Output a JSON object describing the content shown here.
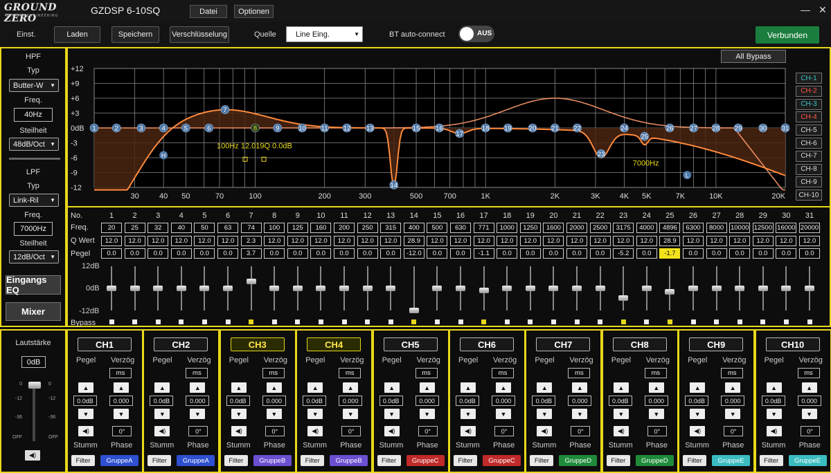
{
  "app": {
    "logo": "GROUND ZERO",
    "logo_sub": "GERMAN ENGINEERING",
    "title": "GZDSP 6-10SQ"
  },
  "menu": {
    "file": "Datei",
    "options": "Optionen"
  },
  "window": {
    "minimize": "—",
    "close": "✕"
  },
  "toolbar": {
    "settings": "Einst.",
    "load": "Laden",
    "save": "Speichern",
    "encryption": "Verschlüsselung",
    "source_label": "Quelle",
    "source_value": "Line Eing.",
    "bt_label": "BT auto-connect",
    "bt_state": "AUS",
    "status": "Verbunden"
  },
  "hpf": {
    "title": "HPF",
    "type_label": "Typ",
    "type_value": "Butter-W",
    "freq_label": "Freq.",
    "freq_value": "40Hz",
    "slope_label": "Steilheit",
    "slope_value": "48dB/Oct"
  },
  "lpf": {
    "title": "LPF",
    "type_label": "Typ",
    "type_value": "Link-Ril",
    "freq_label": "Freq.",
    "freq_value": "7000Hz",
    "slope_label": "Steilheit",
    "slope_value": "12dB/Oct"
  },
  "side_buttons": {
    "input_eq": "Eingangs EQ",
    "mixer": "Mixer"
  },
  "graph": {
    "all_bypass": "All Bypass",
    "y_ticks": [
      "+12",
      "+9",
      "+6",
      "+3",
      "0dB",
      "-3",
      "-6",
      "-9",
      "-12"
    ],
    "x_ticks": [
      "30",
      "40",
      "50",
      "70",
      "100",
      "200",
      "300",
      "500",
      "700",
      "1K",
      "2K",
      "3K",
      "4K",
      "5K",
      "7K",
      "10K",
      "20K"
    ],
    "annotation_bell": "100Hz 12.019Q 0.0dB",
    "annotation_lpf": "7000Hz",
    "marker_h": "H",
    "marker_l": "L",
    "colors": {
      "curve": "#ff8a3c",
      "fill": "#4a2410",
      "grid": "#8a8a8a",
      "points": "#4e78a8",
      "active_point": "#c8e34a"
    }
  },
  "channels_side": [
    {
      "label": "CH-1",
      "color": "#3ec6c6"
    },
    {
      "label": "CH-2",
      "color": "#ff5a4a"
    },
    {
      "label": "CH-3",
      "color": "#3ec6c6"
    },
    {
      "label": "CH-4",
      "color": "#ff5a4a"
    },
    {
      "label": "CH-5",
      "color": "#dddddd"
    },
    {
      "label": "CH-6",
      "color": "#dddddd"
    },
    {
      "label": "CH-7",
      "color": "#dddddd"
    },
    {
      "label": "CH-8",
      "color": "#dddddd"
    },
    {
      "label": "CH-9",
      "color": "#dddddd"
    },
    {
      "label": "CH-10",
      "color": "#dddddd"
    }
  ],
  "eq_table": {
    "row_labels": {
      "no": "No.",
      "freq": "Freq.",
      "q": "Q Wert",
      "gain": "Pegel",
      "bypass": "Bypass"
    },
    "scale": {
      "top": "12dB",
      "mid": "0dB",
      "bottom": "-12dB"
    },
    "numbers": [
      "1",
      "2",
      "3",
      "4",
      "5",
      "6",
      "7",
      "8",
      "9",
      "10",
      "11",
      "12",
      "13",
      "14",
      "15",
      "16",
      "17",
      "18",
      "19",
      "20",
      "21",
      "22",
      "23",
      "24",
      "25",
      "26",
      "27",
      "28",
      "29",
      "30",
      "31"
    ],
    "freq": [
      "20",
      "25",
      "32",
      "40",
      "50",
      "63",
      "74",
      "100",
      "125",
      "160",
      "200",
      "250",
      "315",
      "400",
      "500",
      "630",
      "771",
      "1000",
      "1250",
      "1600",
      "2000",
      "2500",
      "3175",
      "4000",
      "4896",
      "6300",
      "8000",
      "10000",
      "12500",
      "16000",
      "20000"
    ],
    "q": [
      "12.0",
      "12.0",
      "12.0",
      "12.0",
      "12.0",
      "12.0",
      "2.3",
      "12.0",
      "12.0",
      "12.0",
      "12.0",
      "12.0",
      "12.0",
      "28.9",
      "12.0",
      "12.0",
      "12.0",
      "12.0",
      "12.0",
      "12.0",
      "12.0",
      "12.0",
      "12.0",
      "12.0",
      "28.9",
      "12.0",
      "12.0",
      "12.0",
      "12.0",
      "12.0",
      "12.0"
    ],
    "gain": [
      "0.0",
      "0.0",
      "0.0",
      "0.0",
      "0.0",
      "0.0",
      "3.7",
      "0.0",
      "0.0",
      "0.0",
      "0.0",
      "0.0",
      "0.0",
      "-12.0",
      "0.0",
      "0.0",
      "-1.1",
      "0.0",
      "0.0",
      "0.0",
      "0.0",
      "0.0",
      "-5.2",
      "0.0",
      "-1.7",
      "0.0",
      "0.0",
      "0.0",
      "0.0",
      "0.0",
      "0.0"
    ],
    "gain_db": [
      0,
      0,
      0,
      0,
      0,
      0,
      3.7,
      0,
      0,
      0,
      0,
      0,
      0,
      -12,
      0,
      0,
      -1.1,
      0,
      0,
      0,
      0,
      0,
      -5.2,
      0,
      -1.7,
      0,
      0,
      0,
      0,
      0,
      0
    ],
    "selected_band": 25,
    "bypass_active": [
      7,
      14,
      17,
      23,
      25
    ]
  },
  "master": {
    "title": "Lautstärke",
    "value": "0dB",
    "level": 1.0,
    "scale_left": [
      "0",
      "-12",
      "-36",
      "OFF"
    ],
    "scale_right": [
      "0",
      "-12",
      "-36",
      "OFF"
    ]
  },
  "strip_labels": {
    "level": "Pegel",
    "delay": "Verzög",
    "ms": "ms",
    "mute": "Stumm",
    "phase": "Phase",
    "filter": "Filter"
  },
  "strips": [
    {
      "name": "CH1",
      "level": "0.0dB",
      "delay": "0.000",
      "phase": "0°",
      "group": "GruppeA",
      "group_color": "#2d4fd0",
      "highlight": false
    },
    {
      "name": "CH2",
      "level": "0.0dB",
      "delay": "0.000",
      "phase": "0°",
      "group": "GruppeA",
      "group_color": "#2d4fd0",
      "highlight": false
    },
    {
      "name": "CH3",
      "level": "0.0dB",
      "delay": "0.000",
      "phase": "0°",
      "group": "GruppeB",
      "group_color": "#6b4fd0",
      "highlight": true
    },
    {
      "name": "CH4",
      "level": "0.0dB",
      "delay": "0.000",
      "phase": "0°",
      "group": "GruppeB",
      "group_color": "#6b4fd0",
      "highlight": true
    },
    {
      "name": "CH5",
      "level": "0.0dB",
      "delay": "0.000",
      "phase": "0°",
      "group": "GruppeC",
      "group_color": "#c02a2a",
      "highlight": false
    },
    {
      "name": "CH6",
      "level": "0.0dB",
      "delay": "0.000",
      "phase": "0°",
      "group": "GruppeC",
      "group_color": "#c02a2a",
      "highlight": false
    },
    {
      "name": "CH7",
      "level": "0.0dB",
      "delay": "0.000",
      "phase": "0°",
      "group": "GruppeD",
      "group_color": "#1f8a3a",
      "highlight": false
    },
    {
      "name": "CH8",
      "level": "0.0dB",
      "delay": "0.000",
      "phase": "0°",
      "group": "GruppeD",
      "group_color": "#1f8a3a",
      "highlight": false
    },
    {
      "name": "CH9",
      "level": "0.0dB",
      "delay": "0.000",
      "phase": "0°",
      "group": "GruppeE",
      "group_color": "#3bbcc0",
      "highlight": false
    },
    {
      "name": "CH10",
      "level": "0.0dB",
      "delay": "0.000",
      "phase": "0°",
      "group": "GruppeE",
      "group_color": "#3bbcc0",
      "highlight": false
    }
  ]
}
